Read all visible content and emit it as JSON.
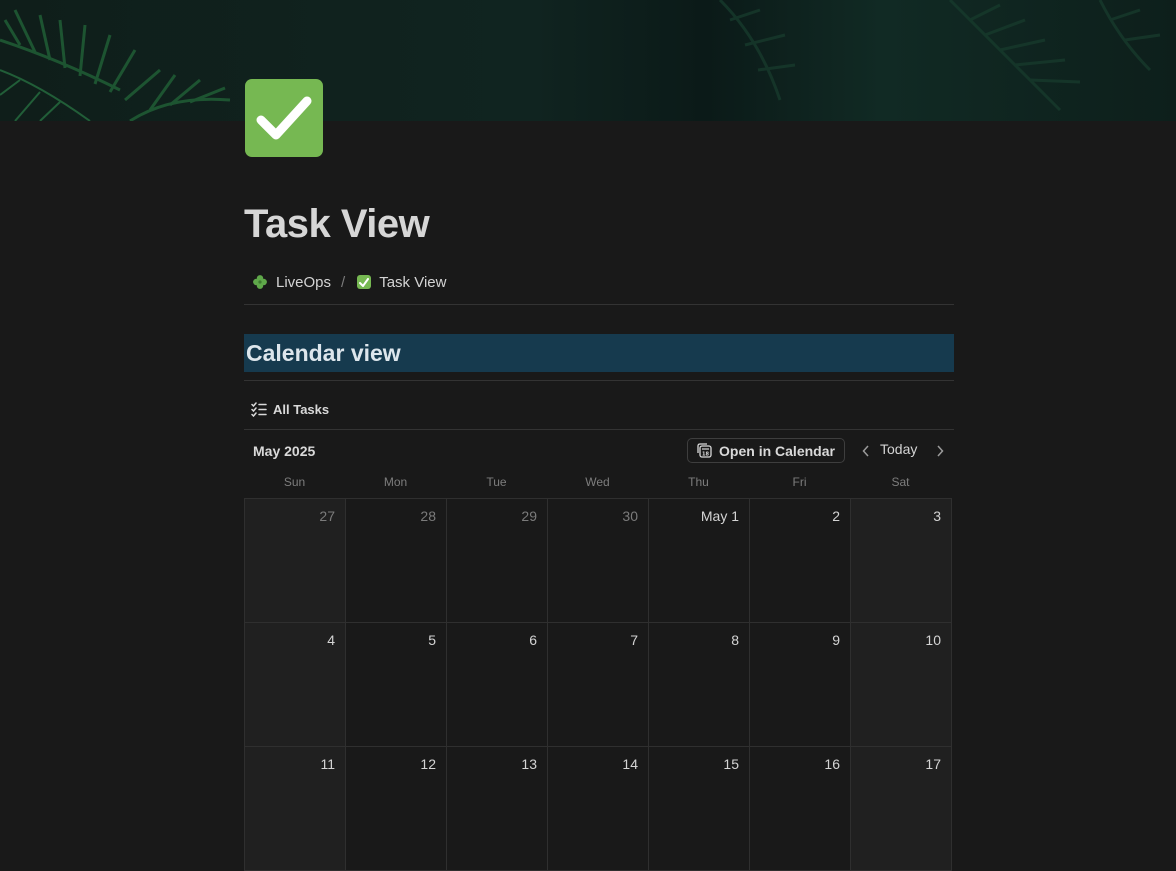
{
  "page": {
    "title": "Task View",
    "icon": "check-mark-button-icon"
  },
  "breadcrumb": {
    "items": [
      {
        "label": "LiveOps",
        "icon": "clover-icon"
      },
      {
        "label": "Task View",
        "icon": "check-mark-button-icon"
      }
    ],
    "separator": "/"
  },
  "section": {
    "heading": "Calendar view",
    "background": "#163a4e"
  },
  "view": {
    "tab_label": "All Tasks",
    "tab_icon": "checklist-icon"
  },
  "calendar": {
    "month_label": "May 2025",
    "open_button_label": "Open in Calendar",
    "today_label": "Today",
    "weekdays": [
      "Sun",
      "Mon",
      "Tue",
      "Wed",
      "Thu",
      "Fri",
      "Sat"
    ],
    "weeks": [
      [
        "27",
        "28",
        "29",
        "30",
        "May 1",
        "2",
        "3"
      ],
      [
        "4",
        "5",
        "6",
        "7",
        "8",
        "9",
        "10"
      ],
      [
        "11",
        "12",
        "13",
        "14",
        "15",
        "16",
        "17"
      ]
    ],
    "outside_month_days": [
      "27",
      "28",
      "29",
      "30"
    ]
  },
  "colors": {
    "background": "#191919",
    "accent_green": "#76b852",
    "heading_blue": "#163a4e"
  }
}
